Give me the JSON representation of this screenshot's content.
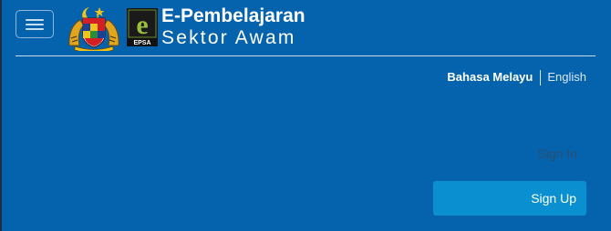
{
  "header": {
    "menu_toggle_icon": "hamburger-menu-icon",
    "coat_of_arms_icon": "coat-of-arms-icon",
    "epsa_logo_icon": "epsa-logo-icon",
    "epsa_logo_text": "EPSA",
    "brand_title": "E-Pembelajaran",
    "brand_subtitle": "Sektor Awam"
  },
  "language": {
    "malay_label": "Bahasa Melayu",
    "english_label": "English",
    "active": "Bahasa Melayu"
  },
  "auth": {
    "sign_in_label": "Sign In",
    "sign_up_label": "Sign Up"
  },
  "colors": {
    "background": "#0563ad",
    "sign_up_button": "#0a8fd1",
    "sign_in_text": "#2b4f73",
    "text_light": "#ffffff"
  }
}
